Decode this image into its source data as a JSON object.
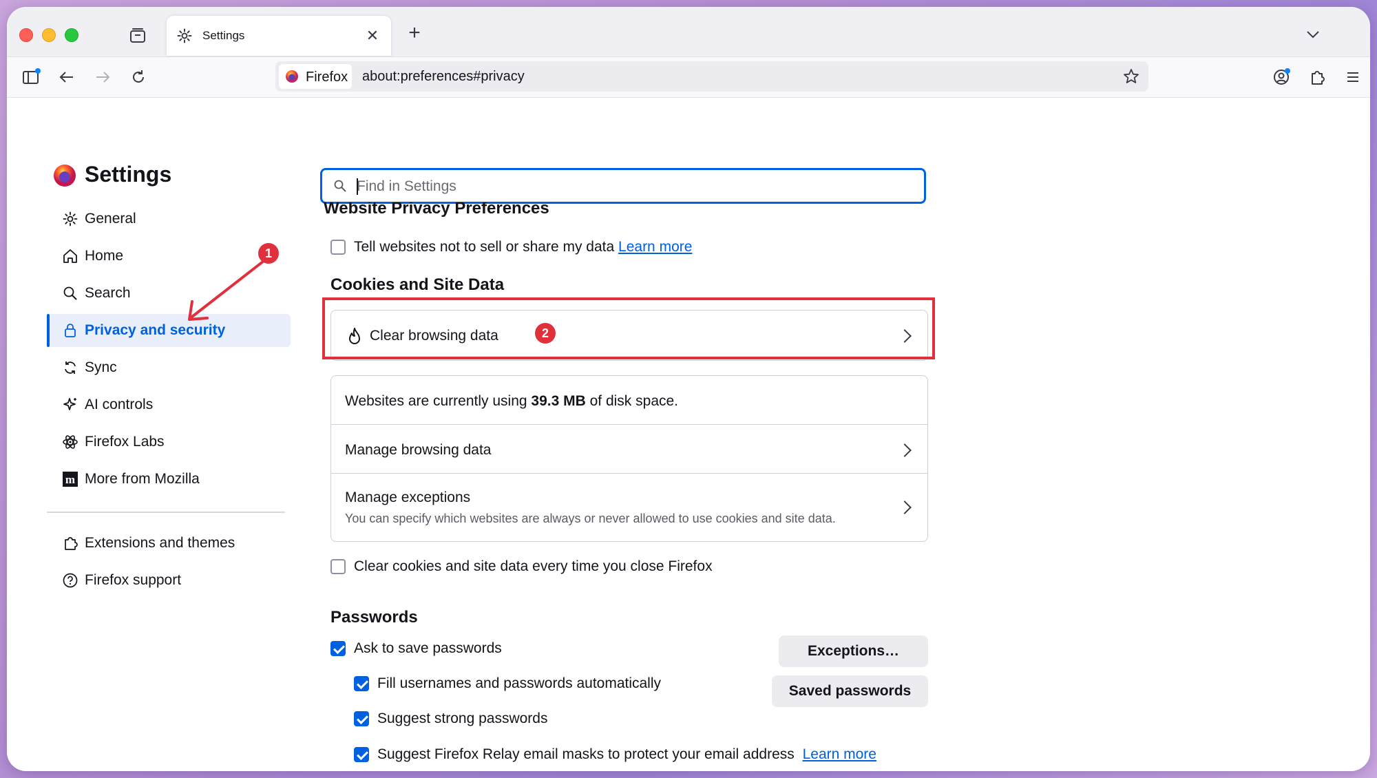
{
  "browser": {
    "tab_title": "Settings",
    "identity_label": "Firefox",
    "url": "about:preferences#privacy"
  },
  "sidebar": {
    "title": "Settings",
    "items": [
      {
        "label": "General",
        "icon": "gear-icon"
      },
      {
        "label": "Home",
        "icon": "home-icon"
      },
      {
        "label": "Search",
        "icon": "search-icon"
      },
      {
        "label": "Privacy and security",
        "icon": "lock-icon",
        "selected": true
      },
      {
        "label": "Sync",
        "icon": "sync-icon"
      },
      {
        "label": "AI controls",
        "icon": "sparkle-icon"
      },
      {
        "label": "Firefox Labs",
        "icon": "labs-icon"
      },
      {
        "label": "More from Mozilla",
        "icon": "mozilla-icon"
      }
    ],
    "footer_items": [
      {
        "label": "Extensions and themes",
        "icon": "puzzle-icon"
      },
      {
        "label": "Firefox support",
        "icon": "help-icon"
      }
    ]
  },
  "search": {
    "placeholder": "Find in Settings"
  },
  "website_privacy": {
    "heading": "Website Privacy Preferences",
    "dont_sell_label": "Tell websites not to sell or share my data",
    "learn_more": "Learn more",
    "dont_sell_checked": false
  },
  "cookies": {
    "heading": "Cookies and Site Data",
    "clear_label": "Clear browsing data",
    "usage_prefix": "Websites are currently using ",
    "usage_amount": "39.3 MB",
    "usage_suffix": " of disk space.",
    "manage_label": "Manage browsing data",
    "exceptions_label": "Manage exceptions",
    "exceptions_desc": "You can specify which websites are always or never allowed to use cookies and site data.",
    "clear_on_close_label": "Clear cookies and site data every time you close Firefox",
    "clear_on_close_checked": false
  },
  "passwords": {
    "heading": "Passwords",
    "ask_save_label": "Ask to save passwords",
    "fill_label": "Fill usernames and passwords automatically",
    "suggest_label": "Suggest strong passwords",
    "relay_label": "Suggest Firefox Relay email masks to protect your email address",
    "relay_learn_more": "Learn more",
    "exceptions_button": "Exceptions…",
    "saved_button": "Saved passwords",
    "ask_save_checked": true,
    "fill_checked": true,
    "suggest_checked": true,
    "relay_checked": true
  },
  "annotations": {
    "badge1": "1",
    "badge2": "2",
    "color": "#e0303c"
  },
  "colors": {
    "accent": "#0061e0",
    "annotation": "#e0303c"
  }
}
